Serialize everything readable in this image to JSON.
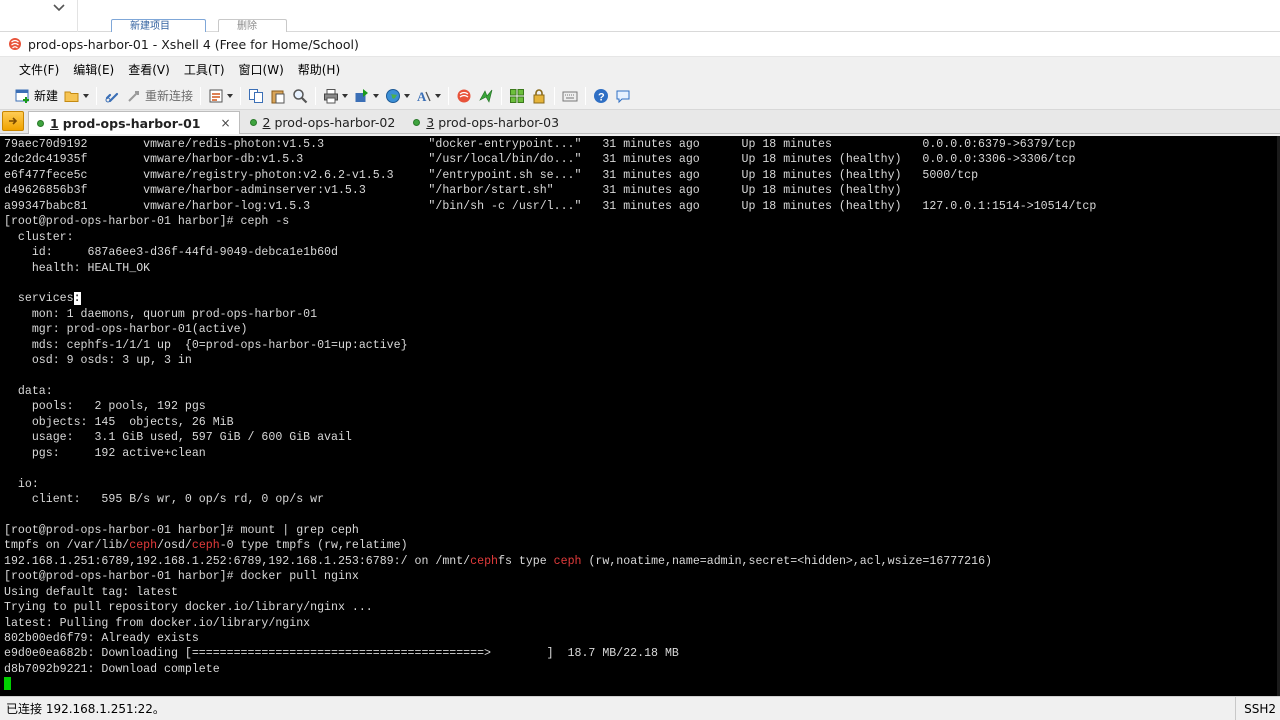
{
  "background_app": {
    "button_1": "新建项目",
    "button_2": "删除"
  },
  "window": {
    "title": "prod-ops-harbor-01 - Xshell 4 (Free for Home/School)"
  },
  "menu": [
    "文件(F)",
    "编辑(E)",
    "查看(V)",
    "工具(T)",
    "窗口(W)",
    "帮助(H)"
  ],
  "toolbar": {
    "new_label": "新建",
    "reconnect_label": "重新连接"
  },
  "tabs": [
    {
      "num": "1",
      "label": "prod-ops-harbor-01",
      "active": true,
      "close": "×"
    },
    {
      "num": "2",
      "label": "prod-ops-harbor-02",
      "active": false
    },
    {
      "num": "3",
      "label": "prod-ops-harbor-03",
      "active": false
    }
  ],
  "terminal": {
    "lines": [
      "79aec70d9192        vmware/redis-photon:v1.5.3               \"docker-entrypoint...\"   31 minutes ago      Up 18 minutes             0.0.0.0:6379->6379/tcp",
      "2dc2dc41935f        vmware/harbor-db:v1.5.3                  \"/usr/local/bin/do...\"   31 minutes ago      Up 18 minutes (healthy)   0.0.0.0:3306->3306/tcp",
      "e6f477fece5c        vmware/registry-photon:v2.6.2-v1.5.3     \"/entrypoint.sh se...\"   31 minutes ago      Up 18 minutes (healthy)   5000/tcp",
      "d49626856b3f        vmware/harbor-adminserver:v1.5.3         \"/harbor/start.sh\"       31 minutes ago      Up 18 minutes (healthy)",
      "a99347babc81        vmware/harbor-log:v1.5.3                 \"/bin/sh -c /usr/l...\"   31 minutes ago      Up 18 minutes (healthy)   127.0.0.1:1514->10514/tcp",
      "[root@prod-ops-harbor-01 harbor]# ceph -s",
      "  cluster:",
      "    id:     687a6ee3-d36f-44fd-9049-debca1e1b60d",
      "    health: HEALTH_OK",
      "",
      "  services:",
      "    mon: 1 daemons, quorum prod-ops-harbor-01",
      "    mgr: prod-ops-harbor-01(active)",
      "    mds: cephfs-1/1/1 up  {0=prod-ops-harbor-01=up:active}",
      "    osd: 9 osds: 3 up, 3 in",
      "",
      "  data:",
      "    pools:   2 pools, 192 pgs",
      "    objects: 145  objects, 26 MiB",
      "    usage:   3.1 GiB used, 597 GiB / 600 GiB avail",
      "    pgs:     192 active+clean",
      "",
      "  io:",
      "    client:   595 B/s wr, 0 op/s rd, 0 op/s wr",
      "",
      "[root@prod-ops-harbor-01 harbor]# mount | grep ceph",
      "tmpfs on /var/lib/ceph/osd/ceph-0 type tmpfs (rw,relatime)",
      "192.168.1.251:6789,192.168.1.252:6789,192.168.1.253:6789:/ on /mnt/cephfs type ceph (rw,noatime,name=admin,secret=<hidden>,acl,wsize=16777216)",
      "[root@prod-ops-harbor-01 harbor]# docker pull nginx",
      "Using default tag: latest",
      "Trying to pull repository docker.io/library/nginx ...",
      "latest: Pulling from docker.io/library/nginx",
      "802b00ed6f79: Already exists",
      "e9d0e0ea682b: Downloading [==========================================>        ]  18.7 MB/22.18 MB",
      "d8b7092b9221: Download complete",
      ""
    ],
    "highlight_word": "ceph",
    "colors": {
      "background": "#000000",
      "text": "#d9d9d9",
      "highlight": "#e23b3b",
      "cursor": "#00d000"
    }
  },
  "status": {
    "connection": "已连接 192.168.1.251:22。",
    "protocol": "SSH2"
  }
}
